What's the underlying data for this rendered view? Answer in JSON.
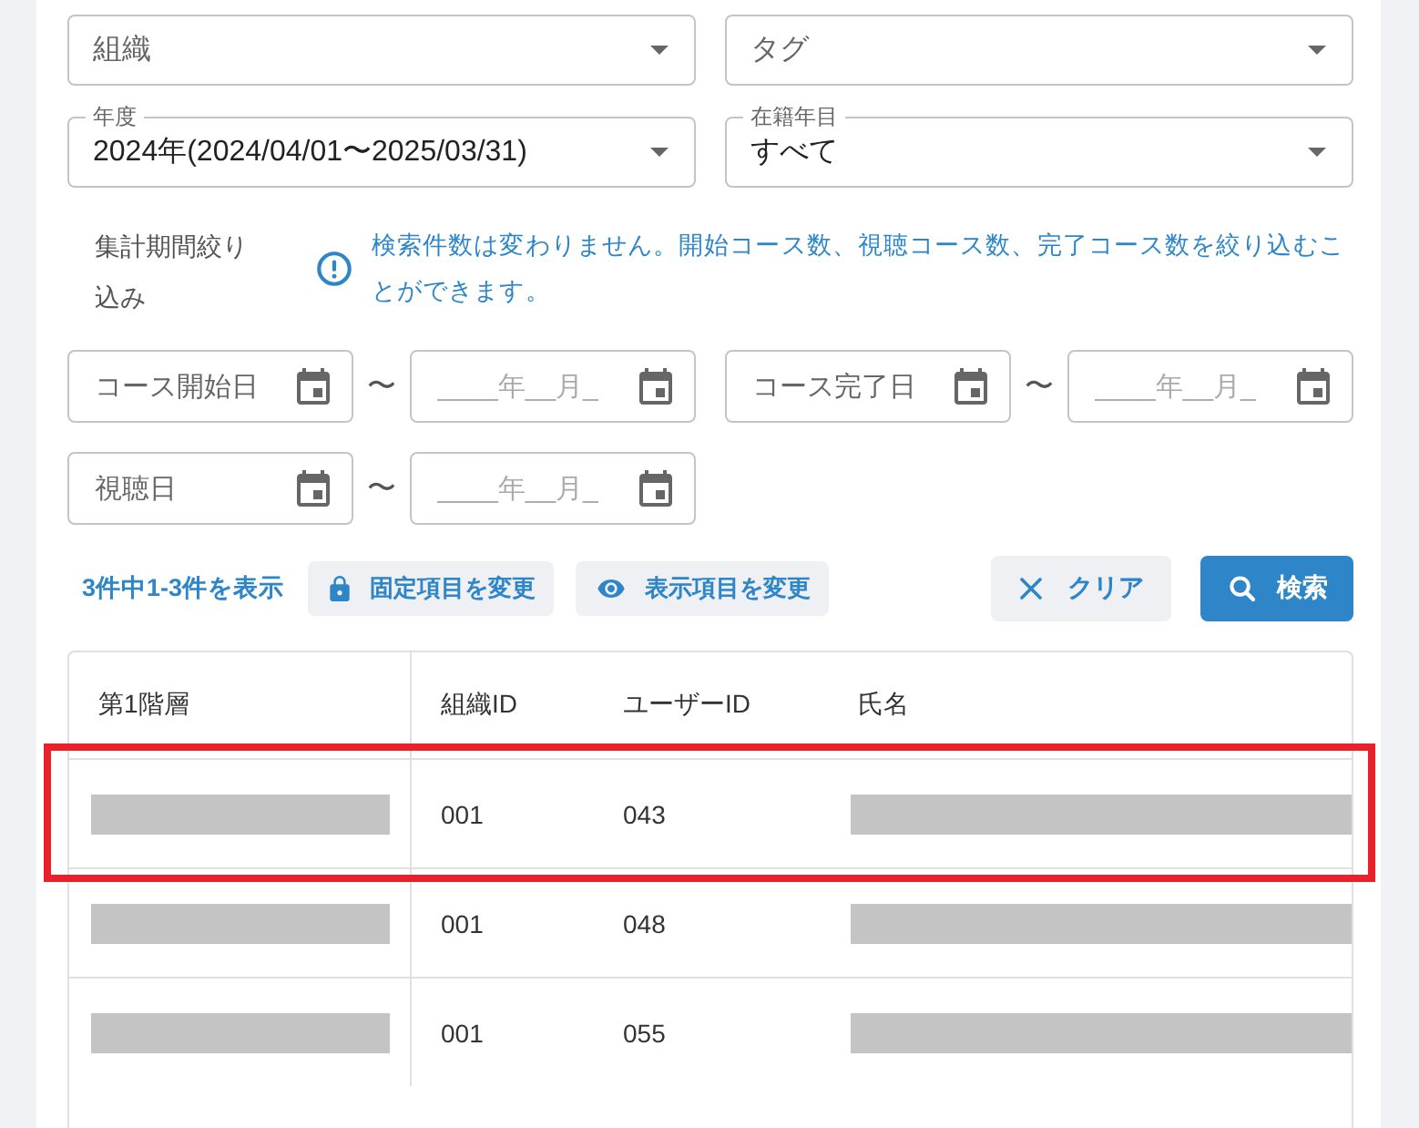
{
  "filters": {
    "selects": [
      {
        "label": "組織"
      },
      {
        "label": "タグ"
      },
      {
        "label": "年度",
        "value": "2024年(2024/04/01〜2025/03/31)"
      },
      {
        "label": "在籍年目",
        "value": "すべて"
      }
    ]
  },
  "period": {
    "label": "集計期間絞り込み",
    "note": "検索件数は変わりません。開始コース数、視聴コース数、完了コース数を絞り込むことができます。",
    "ranges": [
      {
        "from_placeholder": "コース開始日",
        "separator": "〜",
        "to_placeholder": "____年__月_"
      },
      {
        "from_placeholder": "コース完了日",
        "separator": "〜",
        "to_placeholder": "____年__月_"
      },
      {
        "from_placeholder": "視聴日",
        "separator": "〜",
        "to_placeholder": "____年__月_"
      }
    ]
  },
  "toolbar": {
    "result_count": "3件中1-3件を表示",
    "buttons": [
      {
        "kind": "lock",
        "label": "固定項目を変更"
      },
      {
        "kind": "eye",
        "label": "表示項目を変更"
      },
      {
        "kind": "clear",
        "label": "クリア"
      },
      {
        "kind": "search",
        "label": "検索"
      }
    ]
  },
  "table": {
    "columns": [
      "第1階層",
      "組織ID",
      "ユーザーID",
      "氏名"
    ],
    "rows": [
      {
        "highlighted": true,
        "cells": [
          {
            "kind": "redacted"
          },
          {
            "kind": "text",
            "text": "001"
          },
          {
            "kind": "text",
            "text": "043"
          },
          {
            "kind": "redacted"
          }
        ]
      },
      {
        "highlighted": false,
        "cells": [
          {
            "kind": "redacted"
          },
          {
            "kind": "text",
            "text": "001"
          },
          {
            "kind": "text",
            "text": "048"
          },
          {
            "kind": "redacted"
          }
        ]
      },
      {
        "highlighted": false,
        "cells": [
          {
            "kind": "redacted"
          },
          {
            "kind": "text",
            "text": "001"
          },
          {
            "kind": "text",
            "text": "055"
          },
          {
            "kind": "redacted"
          }
        ]
      }
    ]
  }
}
